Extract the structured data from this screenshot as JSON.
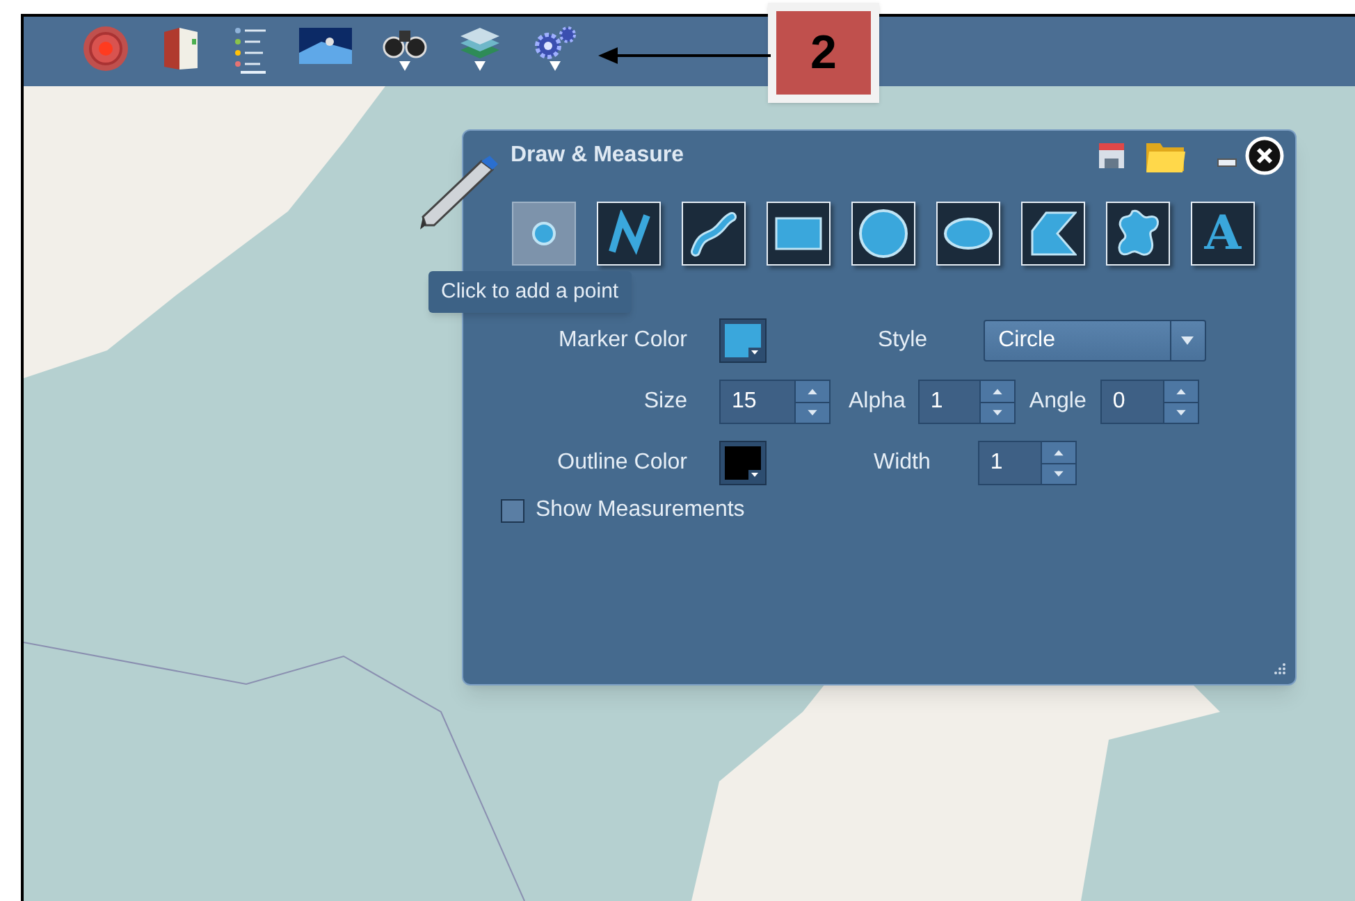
{
  "toolbar": {
    "tools": [
      {
        "kind": "target",
        "has_menu": false
      },
      {
        "kind": "book",
        "has_menu": false
      },
      {
        "kind": "legend",
        "has_menu": false
      },
      {
        "kind": "imagery",
        "has_menu": false
      },
      {
        "kind": "binoculars",
        "has_menu": true
      },
      {
        "kind": "layers",
        "has_menu": true
      },
      {
        "kind": "gears",
        "has_menu": true
      }
    ]
  },
  "callout": {
    "label": "2"
  },
  "panel": {
    "title": "Draw & Measure",
    "tools": [
      {
        "kind": "point",
        "selected": true
      },
      {
        "kind": "polyline",
        "selected": false
      },
      {
        "kind": "freehand",
        "selected": false
      },
      {
        "kind": "rectangle",
        "selected": false
      },
      {
        "kind": "circle",
        "selected": false
      },
      {
        "kind": "ellipse",
        "selected": false
      },
      {
        "kind": "polygon",
        "selected": false
      },
      {
        "kind": "freehand-polygon",
        "selected": false
      },
      {
        "kind": "text",
        "glyph": "A",
        "selected": false
      }
    ],
    "tooltip": "Click to add a point",
    "marker_color": {
      "label": "Marker Color",
      "color": "#3aa7dc"
    },
    "style": {
      "label": "Style",
      "value": "Circle"
    },
    "size": {
      "label": "Size",
      "value": "15"
    },
    "alpha": {
      "label": "Alpha",
      "value": "1"
    },
    "angle": {
      "label": "Angle",
      "value": "0"
    },
    "outline_color": {
      "label": "Outline Color",
      "color": "#000000"
    },
    "width": {
      "label": "Width",
      "value": "1"
    },
    "show_measurements": {
      "label": "Show Measurements",
      "checked": false
    }
  }
}
